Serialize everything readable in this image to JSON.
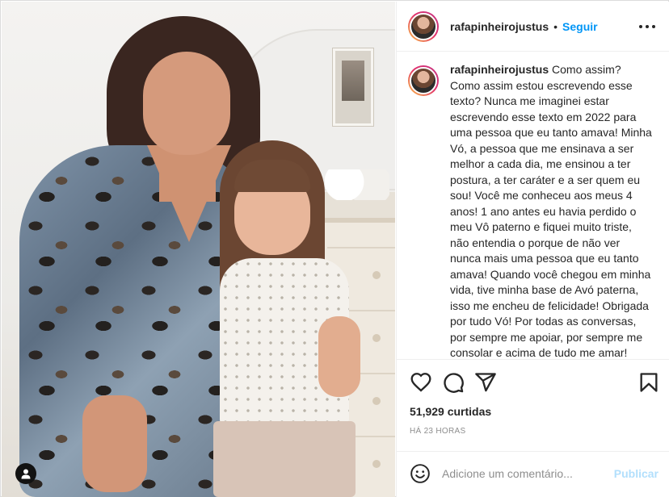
{
  "post": {
    "username": "rafapinheirojustus",
    "separator": "•",
    "follow_label": "Seguir",
    "caption_user": "rafapinheirojustus",
    "caption_text": "Como assim? Como assim estou escrevendo esse texto? Nunca me imaginei estar escrevendo esse texto em 2022 para uma pessoa que eu tanto amava! Minha Vó, a pessoa que me ensinava a ser melhor a cada dia, me ensinou a ter postura, a ter caráter e a ser quem eu sou! Você me conheceu aos meus 4 anos! 1 ano antes eu havia perdido o meu Vô paterno e fiquei muito triste, não entendia o porque de não ver nunca mais uma pessoa que eu tanto amava! Quando você chegou em minha vida, tive minha base de Avó paterna, isso me encheu de felicidade! Obrigada por tudo Vó! Por todas as conversas, por sempre me apoiar, por sempre me consolar e acima de tudo me amar! Você foi a Vó",
    "likes": "51,929 curtidas",
    "time": "HÁ 23 HORAS"
  },
  "comment": {
    "placeholder": "Adicione um comentário...",
    "publish_label": "Publicar"
  },
  "icons": {
    "more": "more-options-icon",
    "like": "heart-icon",
    "comment": "comment-icon",
    "share": "share-icon",
    "save": "bookmark-icon",
    "emoji": "emoji-icon",
    "user_tag": "user-tag-icon"
  },
  "colors": {
    "accent": "#0095f6",
    "publish_disabled": "#b2dffc",
    "text": "#262626",
    "muted": "#8e8e8e",
    "border": "#efefef"
  }
}
